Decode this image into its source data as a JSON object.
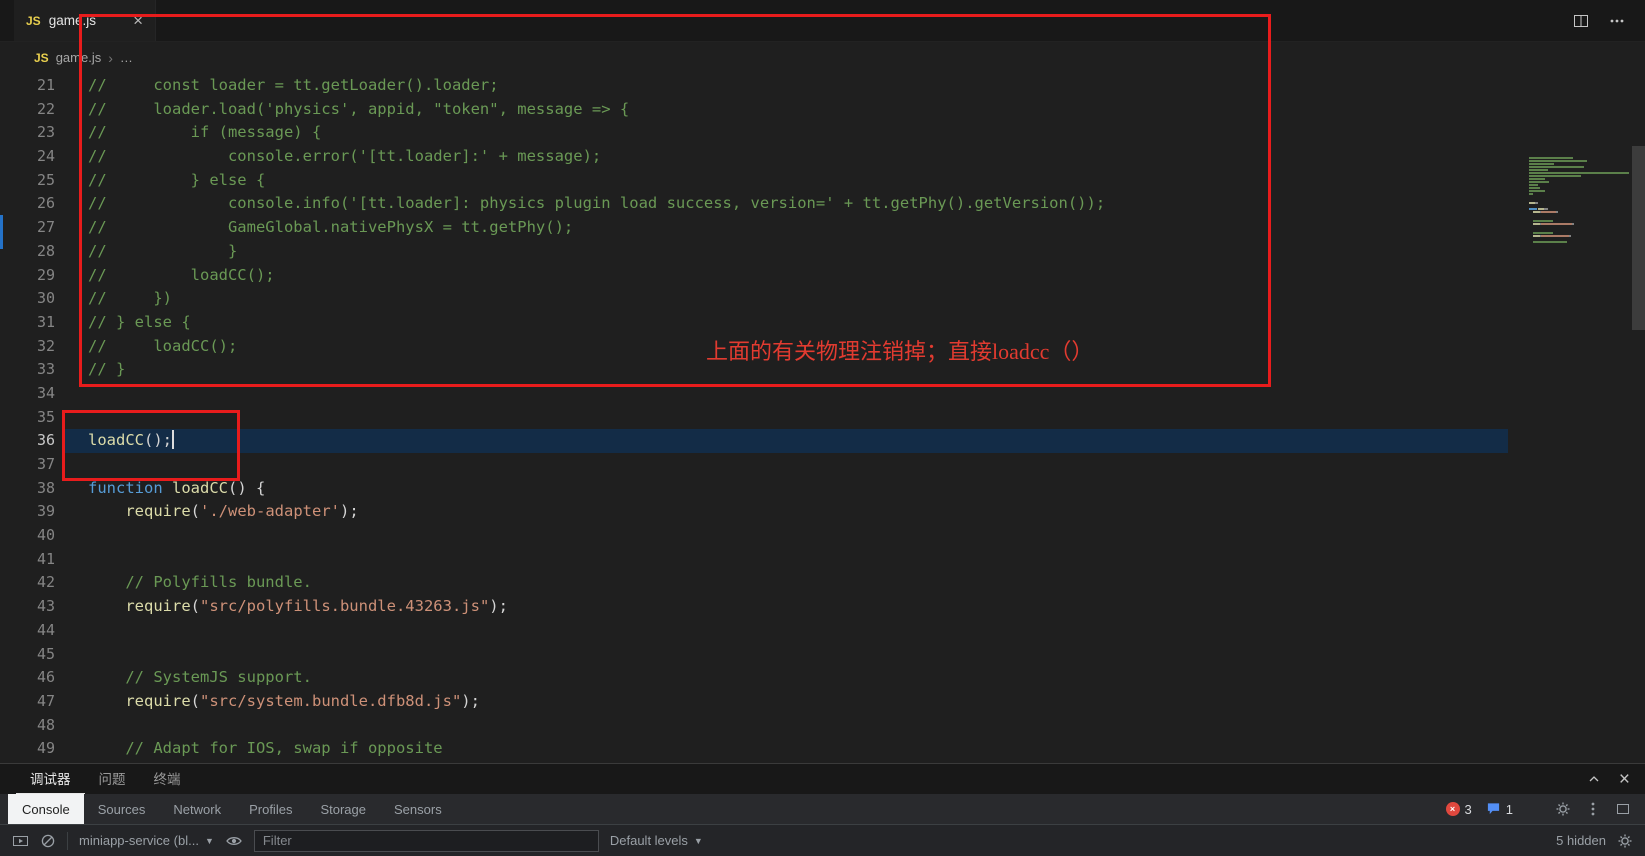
{
  "window": {
    "tab": {
      "icon": "JS",
      "label": "game.js",
      "close": "×"
    }
  },
  "breadcrumb": {
    "icon": "JS",
    "file": "game.js",
    "separator": "›",
    "symbol": "…"
  },
  "palette": {
    "comment": "#6A9955",
    "keyword": "#569CD6",
    "func": "#DCDCAA",
    "string": "#CE9178",
    "plain": "#D4D4D4"
  },
  "editor": {
    "current_line": 36,
    "lines": [
      {
        "n": 21,
        "tokens": [
          {
            "c": "comment",
            "t": "//     const loader = tt.getLoader().loader;"
          }
        ]
      },
      {
        "n": 22,
        "tokens": [
          {
            "c": "comment",
            "t": "//     loader.load('physics', appid, \"token\", message => {"
          }
        ]
      },
      {
        "n": 23,
        "tokens": [
          {
            "c": "comment",
            "t": "//         if (message) {"
          }
        ]
      },
      {
        "n": 24,
        "tokens": [
          {
            "c": "comment",
            "t": "//             console.error('[tt.loader]:' + message);"
          }
        ]
      },
      {
        "n": 25,
        "tokens": [
          {
            "c": "comment",
            "t": "//         } else {"
          }
        ]
      },
      {
        "n": 26,
        "tokens": [
          {
            "c": "comment",
            "t": "//             console.info('[tt.loader]: physics plugin load success, version=' + tt.getPhy().getVersion());"
          }
        ]
      },
      {
        "n": 27,
        "tokens": [
          {
            "c": "comment",
            "t": "//             GameGlobal.nativePhysX = tt.getPhy();"
          }
        ]
      },
      {
        "n": 28,
        "tokens": [
          {
            "c": "comment",
            "t": "//             }"
          }
        ]
      },
      {
        "n": 29,
        "tokens": [
          {
            "c": "comment",
            "t": "//         loadCC();"
          }
        ]
      },
      {
        "n": 30,
        "tokens": [
          {
            "c": "comment",
            "t": "//     })"
          }
        ]
      },
      {
        "n": 31,
        "tokens": [
          {
            "c": "comment",
            "t": "// } else {"
          }
        ]
      },
      {
        "n": 32,
        "tokens": [
          {
            "c": "comment",
            "t": "//     loadCC();"
          }
        ]
      },
      {
        "n": 33,
        "tokens": [
          {
            "c": "comment",
            "t": "// }"
          }
        ]
      },
      {
        "n": 34,
        "tokens": []
      },
      {
        "n": 35,
        "tokens": []
      },
      {
        "n": 36,
        "tokens": [
          {
            "c": "func",
            "t": "loadCC"
          },
          {
            "c": "plain",
            "t": "();"
          }
        ]
      },
      {
        "n": 37,
        "tokens": []
      },
      {
        "n": 38,
        "tokens": [
          {
            "c": "keyword",
            "t": "function"
          },
          {
            "c": "plain",
            "t": " "
          },
          {
            "c": "func",
            "t": "loadCC"
          },
          {
            "c": "plain",
            "t": "() {"
          }
        ]
      },
      {
        "n": 39,
        "tokens": [
          {
            "c": "plain",
            "t": "    "
          },
          {
            "c": "func",
            "t": "require"
          },
          {
            "c": "plain",
            "t": "("
          },
          {
            "c": "string",
            "t": "'./web-adapter'"
          },
          {
            "c": "plain",
            "t": ");"
          }
        ]
      },
      {
        "n": 40,
        "tokens": []
      },
      {
        "n": 41,
        "tokens": []
      },
      {
        "n": 42,
        "tokens": [
          {
            "c": "comment",
            "t": "    // Polyfills bundle."
          }
        ]
      },
      {
        "n": 43,
        "tokens": [
          {
            "c": "plain",
            "t": "    "
          },
          {
            "c": "func",
            "t": "require"
          },
          {
            "c": "plain",
            "t": "("
          },
          {
            "c": "string",
            "t": "\"src/polyfills.bundle.43263.js\""
          },
          {
            "c": "plain",
            "t": ");"
          }
        ]
      },
      {
        "n": 44,
        "tokens": []
      },
      {
        "n": 45,
        "tokens": []
      },
      {
        "n": 46,
        "tokens": [
          {
            "c": "comment",
            "t": "    // SystemJS support."
          }
        ]
      },
      {
        "n": 47,
        "tokens": [
          {
            "c": "plain",
            "t": "    "
          },
          {
            "c": "func",
            "t": "require"
          },
          {
            "c": "plain",
            "t": "("
          },
          {
            "c": "string",
            "t": "\"src/system.bundle.dfb8d.js\""
          },
          {
            "c": "plain",
            "t": ");"
          }
        ]
      },
      {
        "n": 48,
        "tokens": []
      },
      {
        "n": 49,
        "tokens": [
          {
            "c": "comment",
            "t": "    // Adapt for IOS, swap if opposite"
          }
        ]
      }
    ]
  },
  "annotations": {
    "note": "上面的有关物理注销掉；直接loadcc（）",
    "box_color": "#e81c1c"
  },
  "panel": {
    "tabs": [
      {
        "id": "debugger",
        "label": "调试器",
        "active": true
      },
      {
        "id": "problems",
        "label": "问题",
        "active": false
      },
      {
        "id": "terminal",
        "label": "终端",
        "active": false
      }
    ]
  },
  "devtools": {
    "tabs": [
      {
        "id": "console",
        "label": "Console",
        "active": true
      },
      {
        "id": "sources",
        "label": "Sources",
        "active": false
      },
      {
        "id": "network",
        "label": "Network",
        "active": false
      },
      {
        "id": "profiles",
        "label": "Profiles",
        "active": false
      },
      {
        "id": "storage",
        "label": "Storage",
        "active": false
      },
      {
        "id": "sensors",
        "label": "Sensors",
        "active": false
      }
    ],
    "error_count": "3",
    "message_count": "1",
    "toolbar": {
      "context_selector": "miniapp-service (bl...",
      "filter_placeholder": "Filter",
      "levels_label": "Default levels",
      "hidden_label": "5 hidden"
    }
  }
}
